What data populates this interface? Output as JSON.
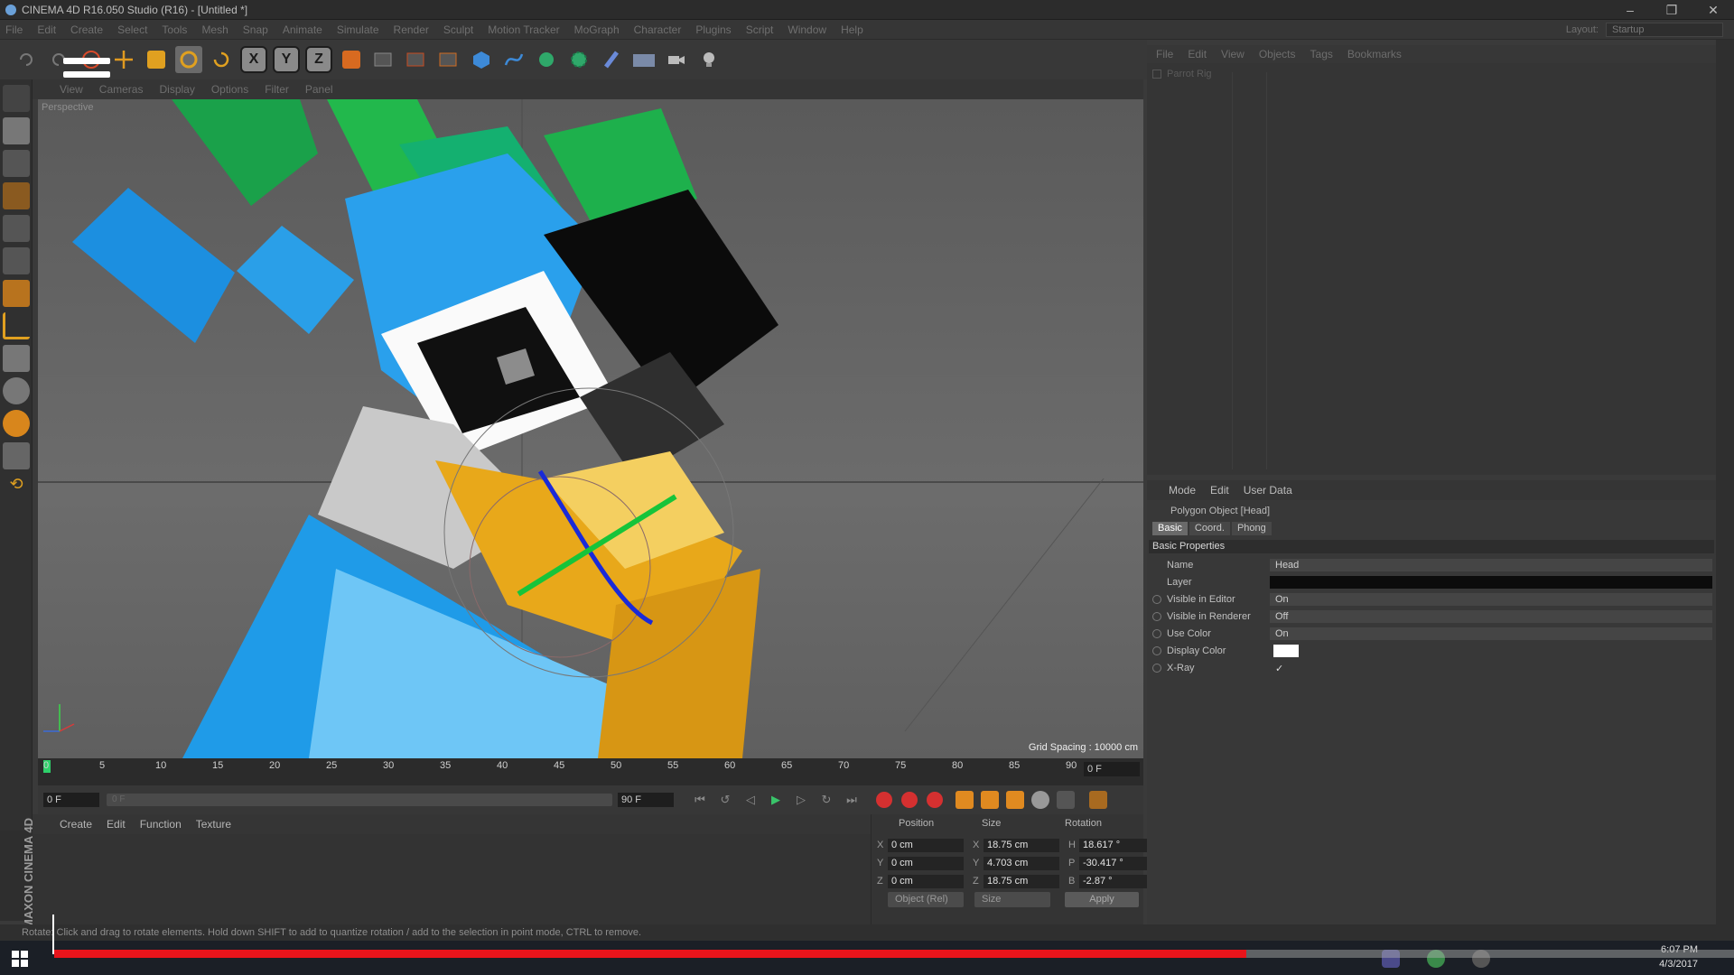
{
  "window": {
    "title": "CINEMA 4D R16.050 Studio (R16) - [Untitled *]"
  },
  "menu": [
    "File",
    "Edit",
    "Create",
    "Select",
    "Tools",
    "Mesh",
    "Snap",
    "Animate",
    "Simulate",
    "Render",
    "Sculpt",
    "Motion Tracker",
    "MoGraph",
    "Character",
    "Plugins",
    "Script",
    "Window",
    "Help"
  ],
  "layout": {
    "label": "Layout:",
    "value": "Startup"
  },
  "toolbar": {
    "axis_x": "X",
    "axis_y": "Y",
    "axis_z": "Z"
  },
  "viewport": {
    "menu": [
      "View",
      "Cameras",
      "Display",
      "Options",
      "Filter",
      "Panel"
    ],
    "label": "Perspective",
    "grid_spacing": "Grid Spacing : 10000 cm"
  },
  "timeline": {
    "ticks": [
      "0",
      "5",
      "10",
      "15",
      "20",
      "25",
      "30",
      "35",
      "40",
      "45",
      "50",
      "55",
      "60",
      "65",
      "70",
      "75",
      "80",
      "85",
      "90"
    ],
    "current_frame": "0 F"
  },
  "transport": {
    "start": "0 F",
    "slider_start": "0 F",
    "slider_end": "90 F",
    "end": "90 F"
  },
  "material_menu": [
    "Create",
    "Edit",
    "Function",
    "Texture"
  ],
  "coords": {
    "headers": {
      "position": "Position",
      "size": "Size",
      "rotation": "Rotation"
    },
    "rows": [
      {
        "axis": "X",
        "pos": "0 cm",
        "saxis": "X",
        "size": "18.75 cm",
        "raxis": "H",
        "rot": "18.617 °"
      },
      {
        "axis": "Y",
        "pos": "0 cm",
        "saxis": "Y",
        "size": "4.703 cm",
        "raxis": "P",
        "rot": "-30.417 °"
      },
      {
        "axis": "Z",
        "pos": "0 cm",
        "saxis": "Z",
        "size": "18.75 cm",
        "raxis": "B",
        "rot": "-2.87 °"
      }
    ],
    "mode": "Object (Rel)",
    "size_mode": "Size",
    "apply": "Apply"
  },
  "object_manager": {
    "menu": [
      "File",
      "Edit",
      "View",
      "Objects",
      "Tags",
      "Bookmarks"
    ],
    "item": "Parrot Rig"
  },
  "attributes": {
    "menu": [
      "Mode",
      "Edit",
      "User Data"
    ],
    "title": "Polygon Object [Head]",
    "tabs": [
      "Basic",
      "Coord.",
      "Phong"
    ],
    "section": "Basic Properties",
    "props": [
      {
        "label": "Name",
        "value": "Head"
      },
      {
        "label": "Layer",
        "value": ""
      },
      {
        "label": "Visible in Editor",
        "value": "On"
      },
      {
        "label": "Visible in Renderer",
        "value": "Off"
      },
      {
        "label": "Use Color",
        "value": "On"
      },
      {
        "label": "Display Color",
        "value": ""
      },
      {
        "label": "X-Ray",
        "value": "✓"
      }
    ]
  },
  "maxon": "MAXON CINEMA 4D",
  "status": "Rotate: Click and drag to rotate elements. Hold down SHIFT to add to quantize rotation / add to the selection in point mode, CTRL to remove.",
  "taskbar": {
    "time": "6:07 PM",
    "date": "4/3/2017"
  },
  "video": {
    "progress": 0.69
  },
  "colors": {
    "accent_red": "#e8141b",
    "green": "#22b14c",
    "blue": "#1f9be8",
    "yellow": "#e8a81a"
  }
}
